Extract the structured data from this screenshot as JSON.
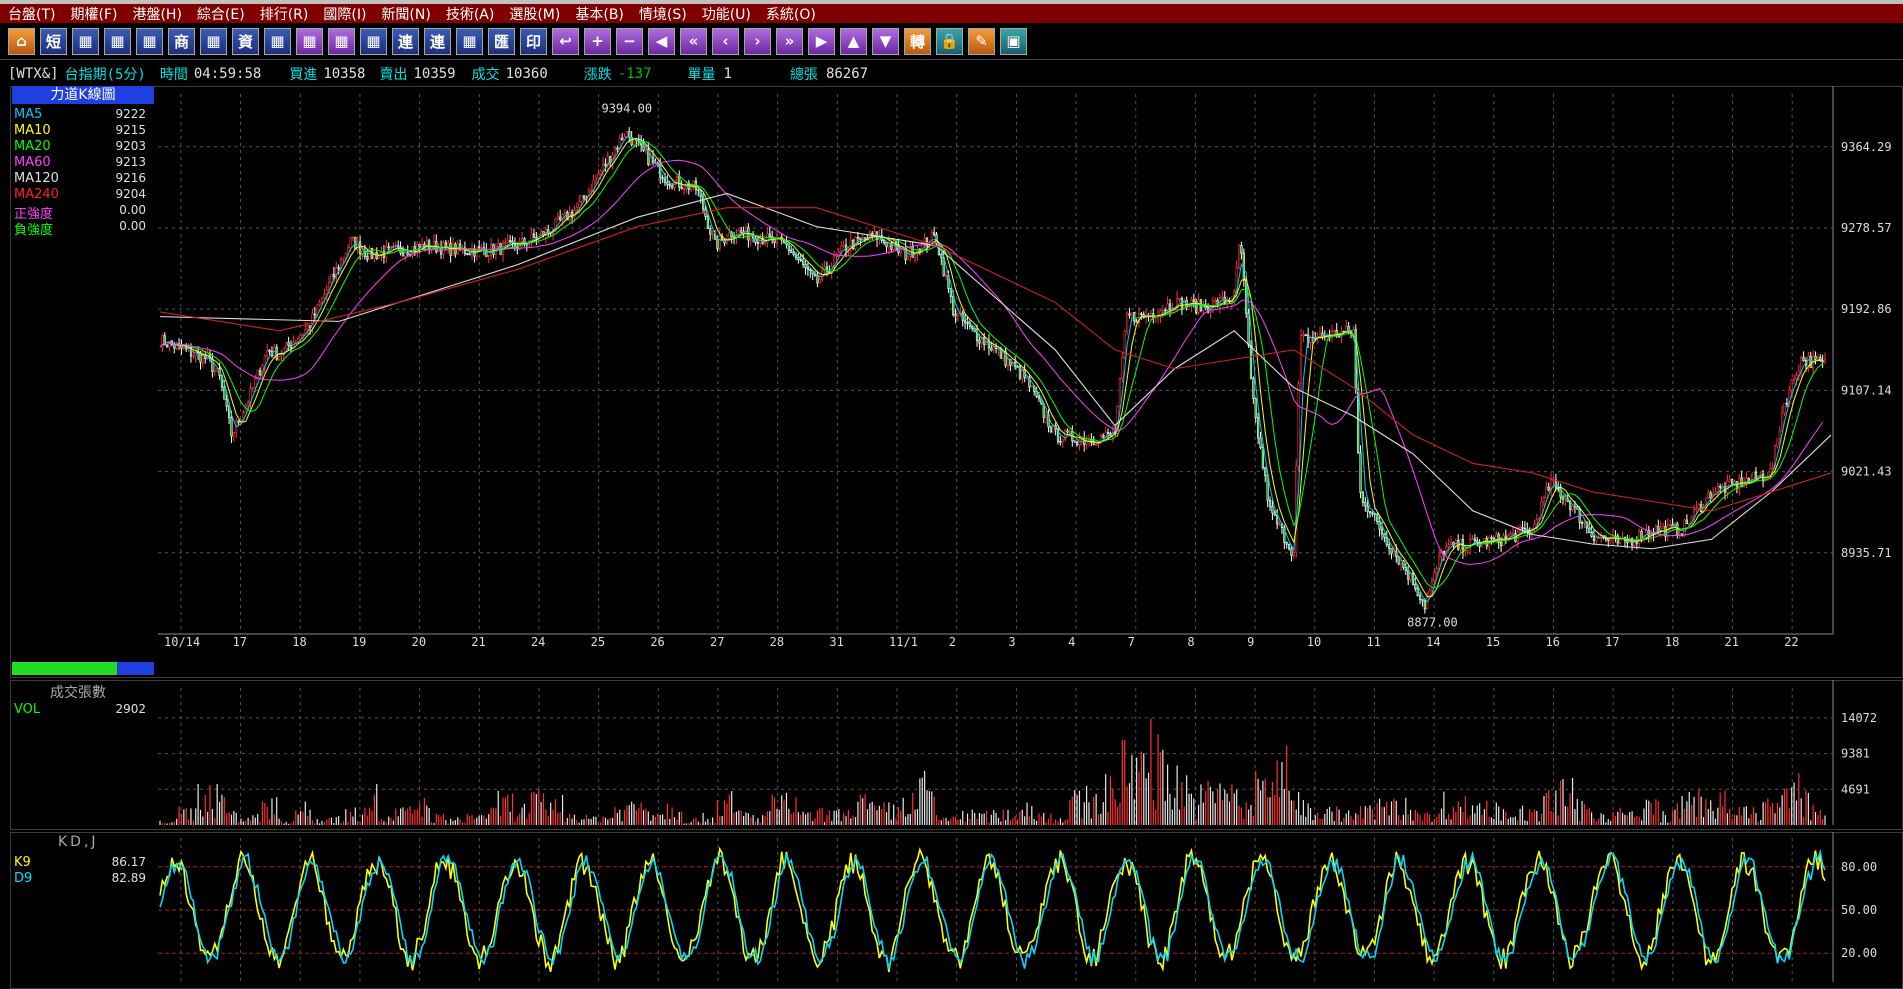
{
  "menu": [
    "台盤(T)",
    "期權(F)",
    "港盤(H)",
    "綜合(E)",
    "排行(R)",
    "國際(I)",
    "新聞(N)",
    "技術(A)",
    "選股(M)",
    "基本(B)",
    "情境(S)",
    "功能(U)",
    "系統(O)"
  ],
  "toolbar": [
    {
      "icon": "home-icon",
      "glyph": "⌂",
      "style": "orange"
    },
    {
      "icon": "short-icon",
      "glyph": "短",
      "style": ""
    },
    {
      "icon": "chart1-icon",
      "glyph": "▦",
      "style": ""
    },
    {
      "icon": "chart2-icon",
      "glyph": "▦",
      "style": ""
    },
    {
      "icon": "chart3-icon",
      "glyph": "▦",
      "style": ""
    },
    {
      "icon": "business-icon",
      "glyph": "商",
      "style": ""
    },
    {
      "icon": "chart4-icon",
      "glyph": "▦",
      "style": ""
    },
    {
      "icon": "capital-icon",
      "glyph": "資",
      "style": ""
    },
    {
      "icon": "chart5-icon",
      "glyph": "▦",
      "style": ""
    },
    {
      "icon": "chart6-icon",
      "glyph": "▦",
      "style": "purple"
    },
    {
      "icon": "chart7-icon",
      "glyph": "▦",
      "style": "purple"
    },
    {
      "icon": "chart8-icon",
      "glyph": "▦",
      "style": ""
    },
    {
      "icon": "connect-icon",
      "glyph": "連",
      "style": ""
    },
    {
      "icon": "connect2-icon",
      "glyph": "連",
      "style": ""
    },
    {
      "icon": "chart9-icon",
      "glyph": "▦",
      "style": ""
    },
    {
      "icon": "remit-icon",
      "glyph": "匯",
      "style": ""
    },
    {
      "icon": "print-icon",
      "glyph": "印",
      "style": ""
    },
    {
      "icon": "esc-icon",
      "glyph": "↩",
      "style": "purple"
    },
    {
      "icon": "plus-icon",
      "glyph": "+",
      "style": "purple"
    },
    {
      "icon": "minus-icon",
      "glyph": "−",
      "style": "purple"
    },
    {
      "icon": "left-icon",
      "glyph": "◀",
      "style": "purple"
    },
    {
      "icon": "fast-left-icon",
      "glyph": "«",
      "style": "purple"
    },
    {
      "icon": "step-left-icon",
      "glyph": "‹",
      "style": "purple"
    },
    {
      "icon": "step-right-icon",
      "glyph": "›",
      "style": "purple"
    },
    {
      "icon": "fast-right-icon",
      "glyph": "»",
      "style": "purple"
    },
    {
      "icon": "right-icon",
      "glyph": "▶",
      "style": "purple"
    },
    {
      "icon": "up-icon",
      "glyph": "▲",
      "style": "purple"
    },
    {
      "icon": "down-icon",
      "glyph": "▼",
      "style": "purple"
    },
    {
      "icon": "transfer-icon",
      "glyph": "轉",
      "style": "orange"
    },
    {
      "icon": "lock-icon",
      "glyph": "🔒",
      "style": "teal"
    },
    {
      "icon": "note-icon",
      "glyph": "✎",
      "style": "orange"
    },
    {
      "icon": "window-icon",
      "glyph": "▣",
      "style": "teal"
    }
  ],
  "info": {
    "symbol": "[WTX&]",
    "name": "台指期(5分)",
    "time_label": "時間",
    "time": "04:59:58",
    "bid_label": "買進",
    "bid": "10358",
    "ask_label": "賣出",
    "ask": "10359",
    "deal_label": "成交",
    "deal": "10360",
    "change_label": "漲跌",
    "change": "-137",
    "qty_label": "單量",
    "qty": "1",
    "total_label": "總張",
    "total": "86267"
  },
  "main": {
    "title": "力道K線圖",
    "legend": [
      {
        "name": "MA5",
        "value": "9222",
        "color": "#00c8ff"
      },
      {
        "name": "MA10",
        "value": "9215",
        "color": "#ffff00"
      },
      {
        "name": "MA20",
        "value": "9203",
        "color": "#00ff00"
      },
      {
        "name": "MA60",
        "value": "9213",
        "color": "#ff40ff"
      },
      {
        "name": "MA120",
        "value": "9216",
        "color": "#e0e0e0"
      },
      {
        "name": "MA240",
        "value": "9204",
        "color": "#ff2020"
      },
      {
        "name": "正強度",
        "value": "0.00",
        "color": "#ff40ff"
      },
      {
        "name": "負強度",
        "value": "0.00",
        "color": "#00ff00"
      }
    ],
    "high_label": "9394.00",
    "low_label": "8877.00",
    "progress": 0.74
  },
  "volume": {
    "title": "成交張數",
    "legend_name": "VOL",
    "legend_value": "2902"
  },
  "kd": {
    "title": "KD,J",
    "k_name": "K9",
    "k_value": "86.17",
    "d_name": "D9",
    "d_value": "82.89"
  },
  "chart_data": [
    {
      "type": "line",
      "title": "力道K線圖",
      "x_ticks": [
        "10/14",
        "17",
        "18",
        "19",
        "20",
        "21",
        "24",
        "25",
        "26",
        "27",
        "28",
        "31",
        "11/1",
        "2",
        "3",
        "4",
        "7",
        "8",
        "9",
        "10",
        "11",
        "14",
        "15",
        "16",
        "17",
        "18",
        "21",
        "22"
      ],
      "y_ticks": [
        9364.29,
        9278.57,
        9192.86,
        9107.14,
        9021.43,
        8935.71
      ],
      "ylim": [
        8850,
        9420
      ],
      "x_range": [
        0,
        28
      ],
      "price_points": [
        [
          0,
          9160
        ],
        [
          0.4,
          9150
        ],
        [
          0.8,
          9140
        ],
        [
          1,
          9120
        ],
        [
          1.2,
          9060
        ],
        [
          1.5,
          9100
        ],
        [
          1.8,
          9150
        ],
        [
          2,
          9145
        ],
        [
          2.5,
          9175
        ],
        [
          3,
          9240
        ],
        [
          3.2,
          9265
        ],
        [
          3.5,
          9250
        ],
        [
          4,
          9255
        ],
        [
          4.5,
          9260
        ],
        [
          5,
          9255
        ],
        [
          5.5,
          9255
        ],
        [
          6,
          9260
        ],
        [
          6.5,
          9275
        ],
        [
          7,
          9300
        ],
        [
          7.5,
          9350
        ],
        [
          7.8,
          9380
        ],
        [
          8,
          9365
        ],
        [
          8.5,
          9330
        ],
        [
          9,
          9320
        ],
        [
          9.3,
          9260
        ],
        [
          9.6,
          9275
        ],
        [
          10,
          9270
        ],
        [
          10.5,
          9260
        ],
        [
          11,
          9220
        ],
        [
          11.5,
          9260
        ],
        [
          12,
          9270
        ],
        [
          12.5,
          9250
        ],
        [
          13,
          9270
        ],
        [
          13.3,
          9190
        ],
        [
          13.6,
          9170
        ],
        [
          14,
          9150
        ],
        [
          14.5,
          9120
        ],
        [
          15,
          9060
        ],
        [
          15.5,
          9055
        ],
        [
          16,
          9060
        ],
        [
          16.2,
          9185
        ],
        [
          16.5,
          9185
        ],
        [
          17,
          9200
        ],
        [
          17.5,
          9195
        ],
        [
          18,
          9205
        ],
        [
          18.1,
          9270
        ],
        [
          18.3,
          9100
        ],
        [
          18.6,
          8980
        ],
        [
          19,
          8935
        ],
        [
          19.1,
          9160
        ],
        [
          19.5,
          9165
        ],
        [
          20,
          9170
        ],
        [
          20.1,
          9000
        ],
        [
          20.5,
          8955
        ],
        [
          21,
          8905
        ],
        [
          21.2,
          8880
        ],
        [
          21.5,
          8940
        ],
        [
          22,
          8945
        ],
        [
          22.5,
          8950
        ],
        [
          23,
          8960
        ],
        [
          23.3,
          9010
        ],
        [
          23.6,
          8990
        ],
        [
          24,
          8955
        ],
        [
          24.5,
          8945
        ],
        [
          25,
          8960
        ],
        [
          25.5,
          8960
        ],
        [
          26,
          9000
        ],
        [
          26.5,
          9010
        ],
        [
          27,
          9020
        ],
        [
          27.2,
          9090
        ],
        [
          27.5,
          9140
        ],
        [
          27.9,
          9135
        ]
      ],
      "ma_series": [
        {
          "name": "MA120",
          "values": [
            [
              0,
              9185
            ],
            [
              3,
              9180
            ],
            [
              6,
              9240
            ],
            [
              8,
              9290
            ],
            [
              9.5,
              9315
            ],
            [
              11,
              9280
            ],
            [
              13,
              9260
            ],
            [
              15,
              9150
            ],
            [
              16,
              9070
            ],
            [
              17,
              9130
            ],
            [
              18,
              9170
            ],
            [
              19,
              9110
            ],
            [
              20,
              9080
            ],
            [
              21,
              9040
            ],
            [
              22,
              8980
            ],
            [
              23,
              8955
            ],
            [
              24,
              8945
            ],
            [
              25,
              8940
            ],
            [
              26,
              8950
            ],
            [
              27,
              9000
            ],
            [
              28,
              9060
            ]
          ]
        },
        {
          "name": "MA240",
          "values": [
            [
              0,
              9190
            ],
            [
              2,
              9170
            ],
            [
              4,
              9200
            ],
            [
              6,
              9235
            ],
            [
              8,
              9280
            ],
            [
              9.5,
              9300
            ],
            [
              11,
              9300
            ],
            [
              13,
              9260
            ],
            [
              15,
              9200
            ],
            [
              16,
              9150
            ],
            [
              17,
              9130
            ],
            [
              18,
              9140
            ],
            [
              19,
              9150
            ],
            [
              20,
              9110
            ],
            [
              21,
              9060
            ],
            [
              22,
              9030
            ],
            [
              23,
              9020
            ],
            [
              24,
              9000
            ],
            [
              25,
              8990
            ],
            [
              26,
              8980
            ],
            [
              27,
              9000
            ],
            [
              28,
              9020
            ]
          ]
        }
      ]
    },
    {
      "type": "bar",
      "title": "成交張數",
      "y_ticks": [
        14072,
        9381,
        4691
      ],
      "ylim": [
        0,
        18000
      ],
      "series": [
        {
          "name": "VOL",
          "values": [
            800,
            2500,
            6000,
            5200,
            2000,
            1500,
            4500,
            800,
            3000,
            1000,
            1300,
            2200,
            5500,
            1200,
            2500,
            3600,
            1500,
            1000,
            1700,
            2400,
            4300,
            3000,
            4500,
            4000,
            2000,
            1300,
            1600,
            3100,
            4100,
            2700,
            3500,
            1000,
            1500,
            4500,
            2200,
            1500,
            4000,
            4100,
            1800,
            2200,
            2100,
            4600,
            3000,
            3000,
            4400,
            7000,
            1300,
            1800,
            2000,
            1900,
            2200,
            3400,
            2000,
            1300,
            4500,
            5000,
            7500,
            11000,
            16000,
            12000,
            8000,
            5300,
            6000,
            8000,
            3000,
            9000,
            10000,
            5500,
            3000,
            2500,
            2100,
            2600,
            4100,
            3500,
            3300,
            1700,
            4500,
            3800,
            3700,
            3000,
            2500,
            2100,
            4800,
            6000,
            3300,
            2000,
            2500,
            1800,
            3700,
            2000,
            4200,
            5000,
            4400,
            2500,
            2500,
            4000,
            5000,
            6500,
            2902
          ]
        }
      ]
    },
    {
      "type": "line",
      "title": "KD,J",
      "y_ticks": [
        80,
        50,
        20
      ],
      "ylim": [
        0,
        100
      ],
      "series": [
        {
          "name": "K9",
          "last": 86.17
        },
        {
          "name": "D9",
          "last": 82.89
        }
      ]
    }
  ]
}
